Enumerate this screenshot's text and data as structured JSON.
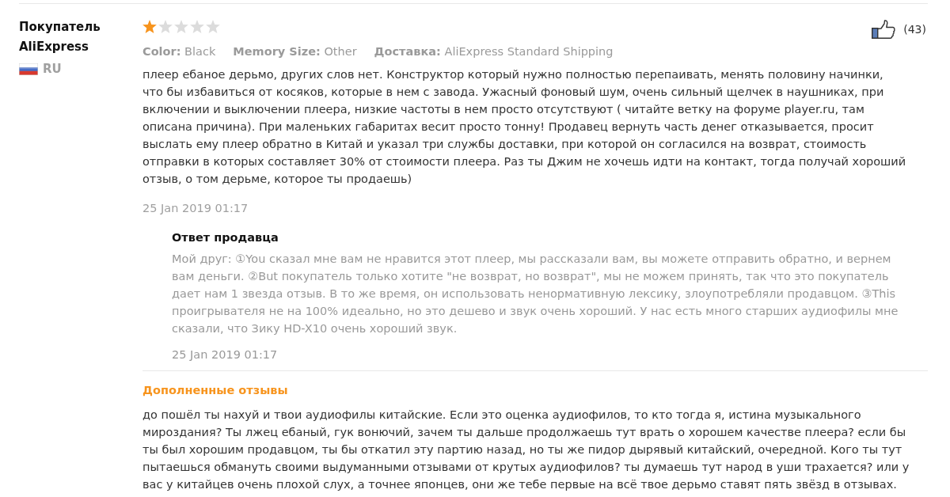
{
  "reviewer": {
    "name": "Покупатель AliExpress",
    "country": "RU"
  },
  "review": {
    "stars": 1,
    "likes": "(43)",
    "attributes": [
      "**Color:** Black",
      "**Memory Size:** Other",
      "**Доставка:** AliExpress Standard Shipping"
    ],
    "text": "плеер ебаное дерьмо, других слов нет. Конструктор который нужно полностью перепаивать, менять половину начинки, что бы избавиться от косяков, которые в нем с завода. Ужасный фоновый шум, очень сильный щелчек в наушниках, при включении и выключении плеера, низкие частоты в нем просто отсутствуют ( читайте ветку на форуме player.ru, там описана причина). При маленьких габаритах весит просто тонну! Продавец вернуть часть денег отказывается, просит выслать ему плеер обратно в Китай и указал три службы доставки, при которой он согласился на возврат, стоимость отправки в которых составляет 30% от стоимости плеера. Раз ты Джим не хочешь идти на контакт, тогда получай хороший отзыв, о том дерьме, которое ты продаешь)",
    "date": "25 Jan 2019 01:17"
  },
  "seller_reply": {
    "title": "Ответ продавца",
    "text": "Мой друг: ①You сказал мне вам не нравится этот плеер, мы рассказали вам, вы можете отправить обратно, и вернем вам деньги. ②But покупатель только хотите \"не возврат, но возврат\", мы не можем принять, так что это покупатель дает нам 1 звезда отзыв. В то же время, он использовать ненормативную лексику, злоупотребляли продавцом. ③This проигрывателя не на 100% идеально, но это дешево и звук очень хороший. У нас есть много старших аудиофилы мне сказали, что Зику HD-X10 очень хороший звук.",
    "date": "25 Jan 2019 01:17"
  },
  "additional_review": {
    "title": "Дополненные отзывы",
    "text": "до пошёл ты нахуй и твои аудиофилы китайские. Если это оценка аудиофилов, то кто тогда я, истина музыкального мироздания? Ты лжец ебаный, гук вонючий, зачем ты дальше продолжаешь тут врать о хорошем качестве плеера? если бы ты был хорошим продавцом, ты бы откатил эту партию назад, но ты же пидор дырявый китайский, очередной. Кого ты тут пытаешься обмануть своими выдуманными отзывами от крутых аудиофилов? ты думаешь тут народ в уши трахается? или у вас у китайцев очень плохой слух, а точнее японцев, они же тебе первые на всё твое дерьмо ставят пять звёзд в отзывах."
  }
}
